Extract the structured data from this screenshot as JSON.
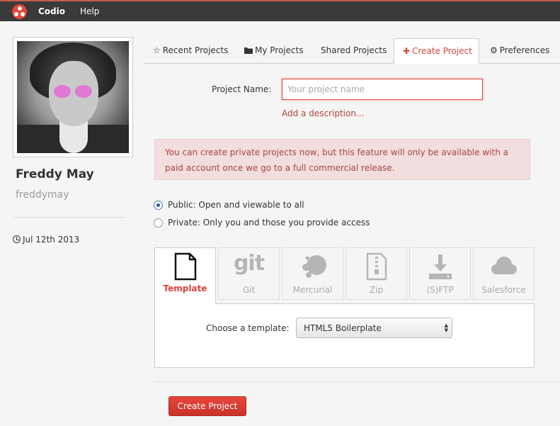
{
  "topbar": {
    "brand": "Codio",
    "help": "Help"
  },
  "profile": {
    "name": "Freddy May",
    "username": "freddymay",
    "joined": "Jul 12th 2013"
  },
  "tabs": [
    {
      "label": "Recent Projects",
      "icon": "star-icon",
      "active": false
    },
    {
      "label": "My Projects",
      "icon": "folder-icon",
      "active": false
    },
    {
      "label": "Shared Projects",
      "icon": "",
      "active": false
    },
    {
      "label": "Create Project",
      "icon": "plus-icon",
      "active": true
    },
    {
      "label": "Preferences",
      "icon": "gear-icon",
      "active": false
    }
  ],
  "form": {
    "project_name_label": "Project Name:",
    "project_name_placeholder": "Your project name",
    "project_name_value": "",
    "add_description": "Add a description..."
  },
  "alert": {
    "text": "You can create private projects now, but this feature will only be available with a paid account once we go to a full commercial release."
  },
  "visibility": {
    "public_label": "Public: Open and viewable to all",
    "private_label": "Private: Only you and those you provide access",
    "selected": "public"
  },
  "sources": [
    {
      "label": "Template",
      "icon": "document-icon",
      "active": true
    },
    {
      "label": "Git",
      "icon": "git-icon",
      "active": false
    },
    {
      "label": "Mercurial",
      "icon": "mercurial-icon",
      "active": false
    },
    {
      "label": "Zip",
      "icon": "zip-icon",
      "active": false
    },
    {
      "label": "(S)FTP",
      "icon": "download-icon",
      "active": false
    },
    {
      "label": "Salesforce",
      "icon": "cloud-icon",
      "active": false
    }
  ],
  "template": {
    "label": "Choose a template:",
    "selected": "HTML5 Boilerplate"
  },
  "create_button": "Create Project",
  "colors": {
    "accent": "#d9433b",
    "topbar": "#3a3a3a",
    "alert_bg": "#f2dede",
    "alert_text": "#a94442",
    "link": "#b3413a"
  }
}
